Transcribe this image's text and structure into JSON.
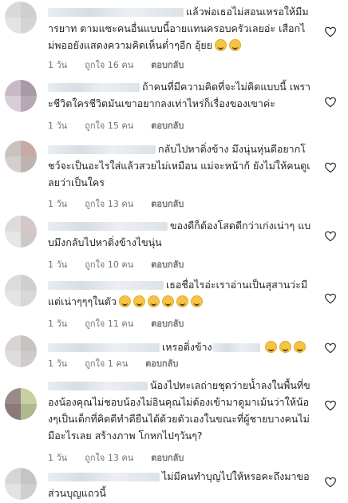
{
  "comments": [
    {
      "text": "แล้วพ่อเธอไม่สอนเหรอให้มีมารยาท ตามแซะคนอื่นแบบนี้อายแทนครอบครัวเลยอ่ะ เสือกไม่พออยังแสดงความคิดเห็นต่ำๆอีก อุ้ยย",
      "emoji_count": 2,
      "time": "1 วัน",
      "likes": "ถูกใจ 16 คน",
      "reply": "ตอบกลับ"
    },
    {
      "text": "ถ้าคนที่มีความคิดที่จะไม่คิดแบบนี้ เพราะชีวิตใครชีวิตมันเขาอยากลงเท่าไหร่ก็เรื่องของเขาค่ะ",
      "emoji_count": 0,
      "time": "1 วัน",
      "likes": "ถูกใจ 15 คน",
      "reply": "ตอบกลับ"
    },
    {
      "text": "กลับไปหาติ่งข้าง มึงนุ่นหุ่นดีอยากโชว์จะเป็นอะไรใส่แล้วสวยไม่เหมือน แม่จะหน้าก้ ยังไม่ให้คนดูเลยว่าเป็นใคร",
      "emoji_count": 0,
      "time": "1 วัน",
      "likes": "ถูกใจ 13 คน",
      "reply": "ตอบกลับ"
    },
    {
      "text": "ของดีก็ต้องโสดดีกว่าเก่งเน่าๆ แบบมึงกลับไปหาติ่งข้างไขนุ่น",
      "emoji_count": 0,
      "time": "1 วัน",
      "likes": "ถูกใจ 10 คน",
      "reply": "ตอบกลับ"
    },
    {
      "text": "เธอชื่อไรอ่ะเราอ่านเป็นสุสานว่ะมีแต่เน่าๆๆๆในตัว",
      "emoji_count": 6,
      "time": "1 วัน",
      "likes": "ถูกใจ 11 คน",
      "reply": "ตอบกลับ"
    },
    {
      "text": "เหรอติ่งข้าง",
      "emoji_count": 3,
      "time": "1 วัน",
      "likes": "ถูกใจ 1 คน",
      "reply": "ตอบกลับ"
    },
    {
      "text": "น้องไปทะเลถ่ายชุดว่ายน้ำลงในพื้นที่ของน้องคุณไม่ชอบน้องไม่อินคุณไม่ต้องเข้ามาดูมาเม้นว่าให้น้องๆเป็นเด็กที่คิดดีทำดียืนได้ด้วยตัวเองในขณะที่ผู้ชายบางคนไม่มีอะไรเลย สร้างภาพ โกหกไปๆวันๆ?",
      "emoji_count": 0,
      "time": "1 วัน",
      "likes": "ถูกใจ 13 คน",
      "reply": "ตอบกลับ"
    },
    {
      "text": "ไม่มีคนทำบุญไปให้หรอคะถึงมาขอส่วนบุญแถวนี้",
      "emoji_count": 0,
      "time": "",
      "likes": "",
      "reply": ""
    }
  ],
  "avatar_palettes": [
    [
      "#d9d9d9",
      "#cfcfcf",
      "#e3e3e3",
      "#d4d4d4"
    ],
    [
      "#c9b9c4",
      "#a89aa8",
      "#d8cfd6",
      "#b7a8b6"
    ],
    [
      "#c9c3c0",
      "#c7a9a6",
      "#d4cfcd",
      "#bfb3b1"
    ],
    [
      "#dcdcdc",
      "#d6c8c8",
      "#e6e6e6",
      "#cfc8c8"
    ],
    [
      "#dcdcdc",
      "#cfcfcf",
      "#e4e4e4",
      "#d8d8d8"
    ],
    [
      "#d8d4d4",
      "#c7c3c3",
      "#e0dcdc",
      "#cfcbcb"
    ],
    [
      "#9a8a8a",
      "#c8d0a0",
      "#8a7a7a",
      "#b0b890"
    ],
    [
      "#d6d6d6",
      "#c8c4c4",
      "#e2e2e2",
      "#cfcfcf"
    ]
  ],
  "icons": {
    "like": "heart-outline-icon",
    "emoji": "grinning-sweat-emoji"
  }
}
